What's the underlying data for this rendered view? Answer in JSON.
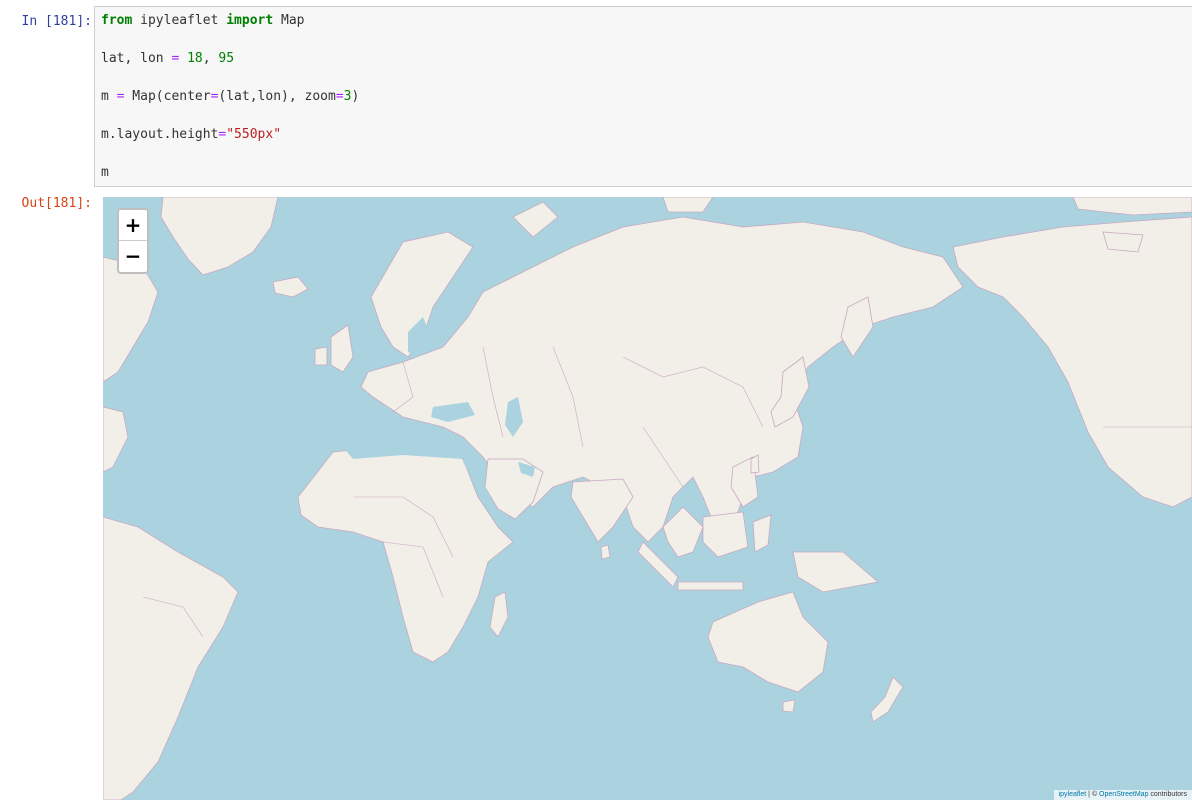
{
  "input_cell": {
    "prompt": "In [181]:",
    "lines": [
      {
        "tokens": [
          [
            "kw",
            "from"
          ],
          [
            "plain",
            " ipyleaflet "
          ],
          [
            "kw",
            "import"
          ],
          [
            "plain",
            " Map"
          ]
        ]
      },
      {
        "tokens": [
          [
            "plain",
            "lat, lon "
          ],
          [
            "op",
            "="
          ],
          [
            "plain",
            " "
          ],
          [
            "num",
            "18"
          ],
          [
            "plain",
            ", "
          ],
          [
            "num",
            "95"
          ]
        ]
      },
      {
        "tokens": [
          [
            "plain",
            "m "
          ],
          [
            "op",
            "="
          ],
          [
            "plain",
            " Map(center"
          ],
          [
            "op",
            "="
          ],
          [
            "plain",
            "(lat,lon), zoom"
          ],
          [
            "op",
            "="
          ],
          [
            "num",
            "3"
          ],
          [
            "plain",
            ")"
          ]
        ]
      },
      {
        "tokens": [
          [
            "plain",
            "m.layout.height"
          ],
          [
            "op",
            "="
          ],
          [
            "str",
            "\"550px\""
          ]
        ]
      },
      {
        "tokens": [
          [
            "plain",
            "m"
          ]
        ]
      }
    ]
  },
  "output_cell": {
    "prompt": "Out[181]:"
  },
  "map": {
    "zoom_in_label": "+",
    "zoom_out_label": "−",
    "attribution_prefix": "ipyleaflet",
    "attribution_sep": " | © ",
    "attribution_link": "OpenStreetMap",
    "attribution_suffix": " contributors",
    "colors": {
      "water": "#aad3df",
      "land": "#f2efe9",
      "border": "#c8a9c0"
    }
  }
}
